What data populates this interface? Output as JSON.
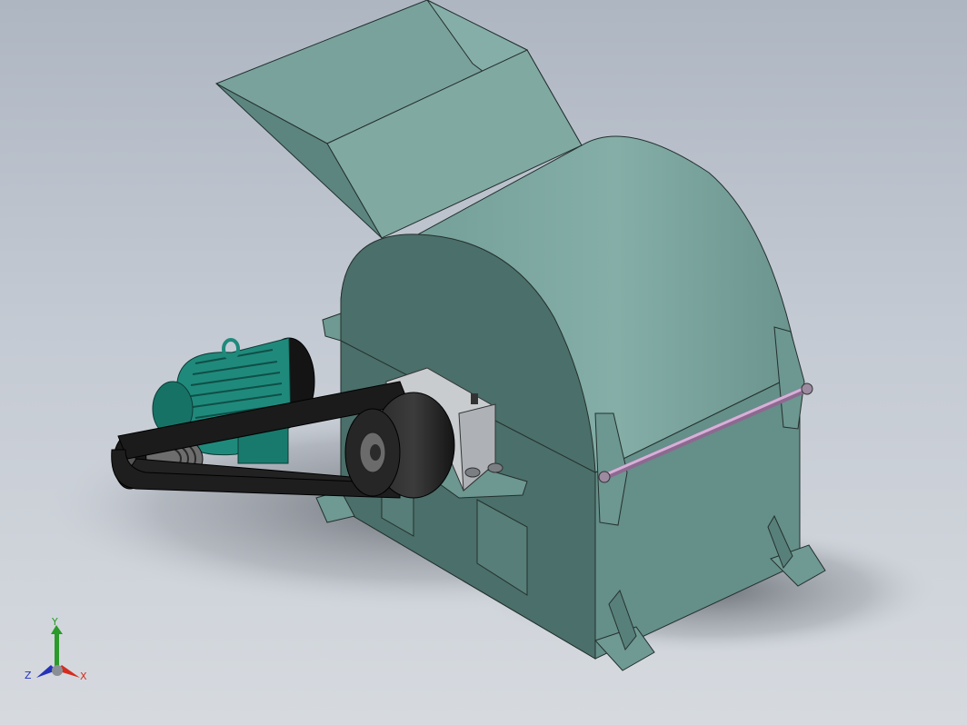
{
  "viewport": {
    "colors": {
      "body": "#76a09a",
      "body_dark": "#4a6e6a",
      "body_mid": "#5f8a84",
      "motor": "#1f8a7c",
      "belt": "#1b1b1b",
      "rod": "#c39ac6",
      "bearing": "#c9cccf"
    }
  },
  "triad": {
    "x_label": "X",
    "y_label": "Y",
    "z_label": "Z",
    "x_color": "#d62c1e",
    "y_color": "#2a9a2a",
    "z_color": "#2433b8"
  }
}
